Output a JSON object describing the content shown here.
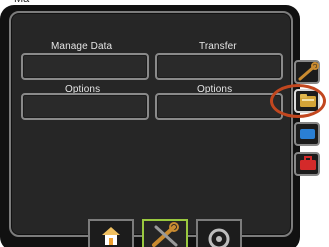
{
  "corner_text": "Ma",
  "main": {
    "buttons": [
      {
        "label": "Manage Data"
      },
      {
        "label": "Transfer"
      },
      {
        "label": "Options"
      },
      {
        "label": "Options"
      }
    ]
  },
  "side_tabs": [
    {
      "icon": "wrench-icon",
      "color": "#b07a2a"
    },
    {
      "icon": "folder-icon",
      "color": "#d4a438"
    },
    {
      "icon": "screen-icon",
      "color": "#2a7fd4"
    },
    {
      "icon": "toolbox-icon",
      "color": "#d42a2a"
    }
  ],
  "bottom_tabs": [
    {
      "icon": "home-icon",
      "active": false
    },
    {
      "icon": "tools-icon",
      "active": true
    },
    {
      "icon": "gauge-icon",
      "active": false
    }
  ],
  "colors": {
    "highlight": "#c2471f",
    "screen_bg": "#262626",
    "active_tab": "#9ac93f"
  }
}
